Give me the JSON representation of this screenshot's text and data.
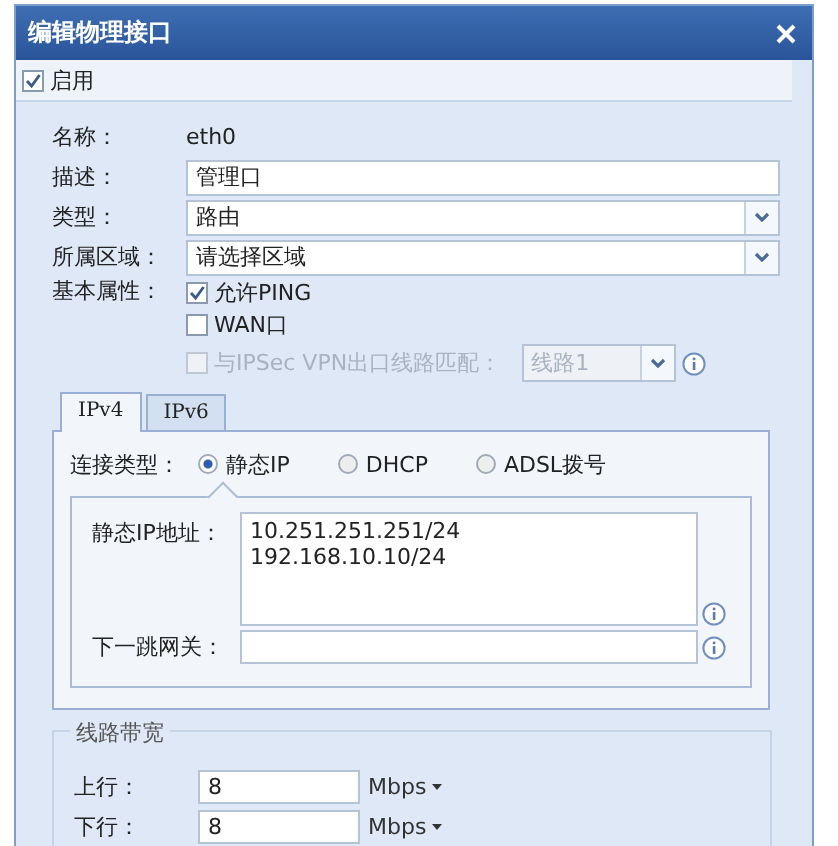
{
  "window": {
    "title": "编辑物理接口"
  },
  "enable": {
    "label": "启用",
    "checked": true
  },
  "form_rows": [
    {
      "kind": "text",
      "label": "名称：",
      "value": "eth0"
    },
    {
      "kind": "input",
      "label": "描述：",
      "value": "管理口"
    },
    {
      "kind": "select",
      "label": "类型：",
      "value": "路由"
    },
    {
      "kind": "select",
      "label": "所属区域：",
      "value": "请选择区域"
    }
  ],
  "basic_attributes": {
    "label": "基本属性：",
    "options": [
      {
        "kind": "checkbox",
        "label": "允许PING",
        "checked": true,
        "disabled": false
      },
      {
        "kind": "checkbox",
        "label": "WAN口",
        "checked": false,
        "disabled": false
      },
      {
        "kind": "checkbox_select",
        "label": "与IPSec VPN出口线路匹配：",
        "checked": false,
        "disabled": true,
        "select_value": "线路1"
      }
    ]
  },
  "tabs": [
    {
      "label": "IPv4",
      "selected": true
    },
    {
      "label": "IPv6",
      "selected": false
    }
  ],
  "connection_type": {
    "label": "连接类型：",
    "options": [
      {
        "label": "静态IP",
        "selected": true
      },
      {
        "label": "DHCP",
        "selected": false
      },
      {
        "label": "ADSL拨号",
        "selected": false
      }
    ]
  },
  "static_ip": {
    "label": "静态IP地址：",
    "value": "10.251.251.251/24\n192.168.10.10/24"
  },
  "gateway": {
    "label": "下一跳网关："
  },
  "bandwidth": {
    "legend": "线路带宽",
    "rows": [
      {
        "label": "上行：",
        "value": "8",
        "unit": "Mbps"
      },
      {
        "label": "下行：",
        "value": "8",
        "unit": "Mbps"
      }
    ]
  }
}
